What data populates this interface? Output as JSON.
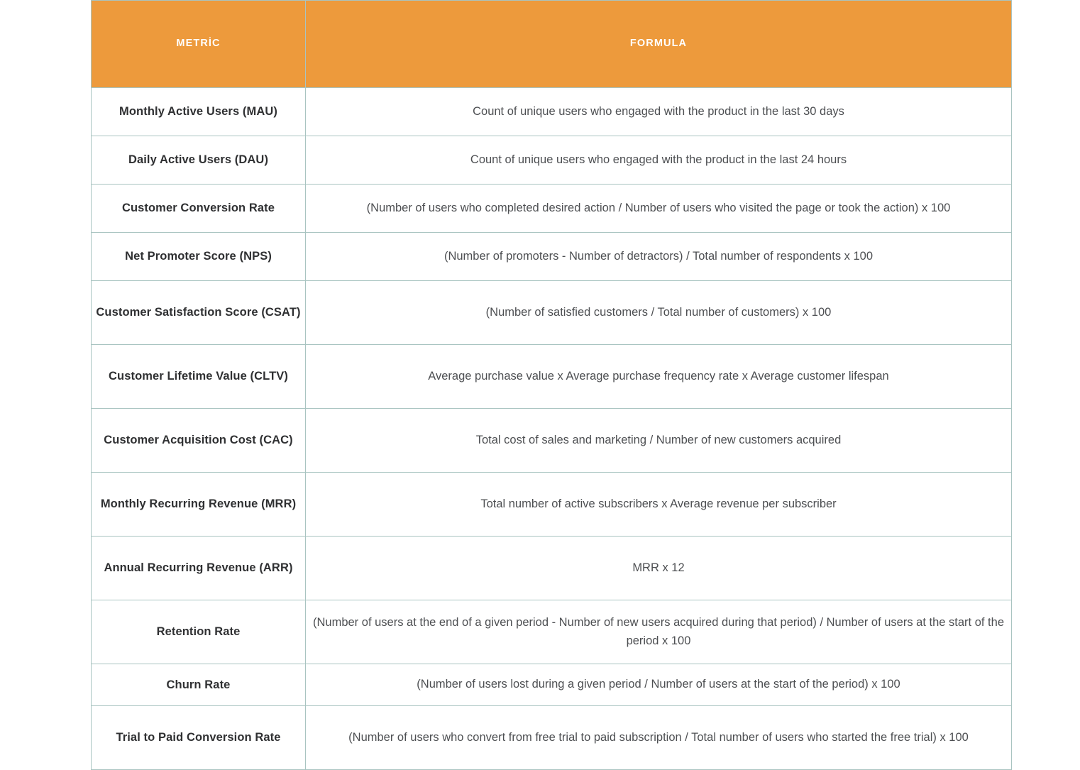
{
  "table": {
    "accent_color": "#ed9a3c",
    "border_color": "#a9c4c1",
    "header_text_color": "#ffffff",
    "metric_text_color": "#2f3032",
    "formula_text_color": "#4d4f52",
    "columns": [
      {
        "key": "metric",
        "label": "METRİC"
      },
      {
        "key": "formula",
        "label": "FORMULA"
      }
    ],
    "rows": [
      {
        "metric": "Monthly Active Users (MAU)",
        "formula": "Count of unique users who engaged with the product in the last 30 days"
      },
      {
        "metric": "Daily Active Users (DAU)",
        "formula": "Count of unique users who engaged with the product in the last 24 hours"
      },
      {
        "metric": "Customer Conversion Rate",
        "formula": "(Number of users who completed desired action / Number of users who visited the page or took the action) x 100"
      },
      {
        "metric": "Net Promoter Score (NPS)",
        "formula": "(Number of promoters - Number of detractors) / Total number of respondents x 100"
      },
      {
        "metric": "Customer Satisfaction Score (CSAT)",
        "formula": "(Number of satisfied customers / Total number of customers) x 100"
      },
      {
        "metric": "Customer Lifetime Value (CLTV)",
        "formula": "Average purchase value x Average purchase frequency rate x Average customer lifespan"
      },
      {
        "metric": "Customer Acquisition Cost (CAC)",
        "formula": "Total cost of sales and marketing / Number of new customers acquired"
      },
      {
        "metric": "Monthly Recurring Revenue (MRR)",
        "formula": "Total number of active subscribers x Average revenue per subscriber"
      },
      {
        "metric": "Annual Recurring Revenue (ARR)",
        "formula": "MRR x 12"
      },
      {
        "metric": "Retention Rate",
        "formula": "(Number of users at the end of a given period - Number of new users acquired during that period) / Number of users at the start of the period x 100"
      },
      {
        "metric": "Churn Rate",
        "formula": "(Number of users lost during a given period / Number of users at the start of the period) x 100"
      },
      {
        "metric": "Trial to Paid Conversion Rate",
        "formula": "(Number of users who convert from free trial to paid subscription / Total number of users who started the free trial) x 100"
      }
    ]
  }
}
